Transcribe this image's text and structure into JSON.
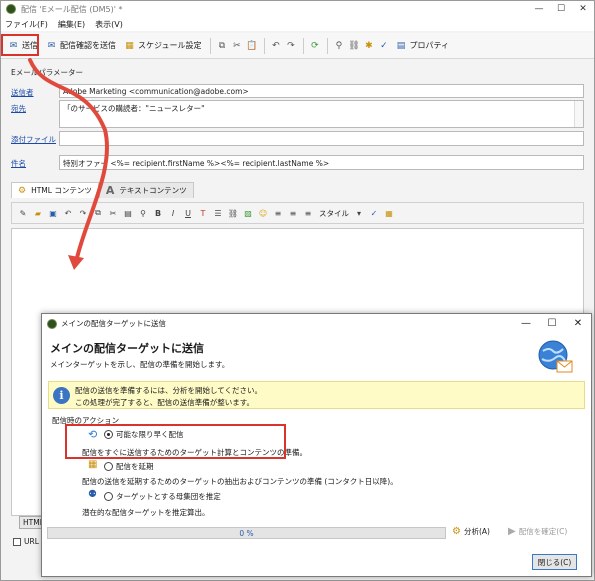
{
  "main_window": {
    "title": "配信 'Eメール配信 (DM5)' *",
    "window_controls": {
      "minimize": "—",
      "maximize": "☐",
      "close": "✕"
    },
    "menu": [
      "ファイル(F)",
      "編集(E)",
      "表示(V)"
    ],
    "toolbar": {
      "send": "送信",
      "send_proof": "配信確認を送信",
      "schedule": "スケジュール設定",
      "properties": "プロパティ"
    },
    "params_label": "Eメールパラメーター",
    "fields": {
      "from_label": "送信者",
      "from_value": "Adobe Marketing <communication@adobe.com>",
      "to_label": "宛先",
      "to_value": "「のサービスの購読者：\"ニュースレター\"",
      "attachment_label": "添付ファイル",
      "attachment_value": "",
      "subject_label": "件名",
      "subject_value": "特別オファー <%= recipient.firstName %><%= recipient.lastName %>"
    },
    "tabs": {
      "html": "HTML コンテンツ",
      "text": "テキストコンテンツ"
    },
    "editor_toolbar": {
      "style_label": "スタイル"
    },
    "bottom_tab": "HTML",
    "url_checkbox_label": "URL を"
  },
  "dialog": {
    "title": "メインの配信ターゲットに送信",
    "window_controls": {
      "minimize": "—",
      "maximize": "☐",
      "close": "✕"
    },
    "heading": "メインの配信ターゲットに送信",
    "subheading": "メインターゲットを示し、配信の準備を開始します。",
    "info_line1": "配信の送信を準備するには、分析を開始してください。",
    "info_line2": "この処理が完了すると、配信の送信準備が整います。",
    "actions_label": "配信時のアクション",
    "option1": {
      "label": "可能な限り早く配信",
      "selected": true,
      "desc": "配信をすぐに送信するためのターゲット計算とコンテンツの準備。"
    },
    "option2": {
      "label": "配信を延期",
      "selected": false,
      "desc": "配信の送信を延期するためのターゲットの抽出およびコンテンツの準備 (コンタクト日以降)。"
    },
    "option3": {
      "label": "ターゲットとする母集団を推定",
      "selected": false,
      "desc": "潜在的な配信ターゲットを推定算出。"
    },
    "progress": 0,
    "progress_label": "0 %",
    "analyze_button": "分析(A)",
    "confirm_button": "配信を確定(C)",
    "close_button": "閉じる(C)"
  },
  "colors": {
    "highlight_red": "#d9342b",
    "arrow_red": "#e04a3c",
    "info_yellow": "#fffbc6",
    "link_blue": "#1a49a8"
  }
}
